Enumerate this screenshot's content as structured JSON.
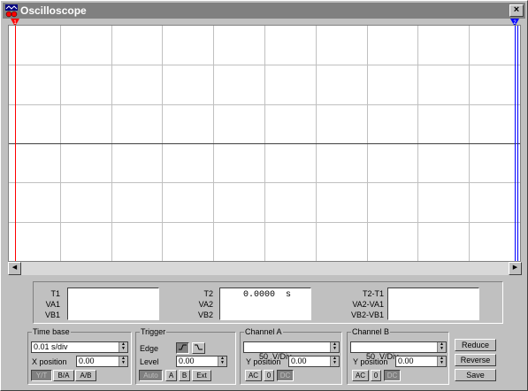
{
  "window": {
    "title": "Oscilloscope",
    "close_label": "×"
  },
  "screen": {
    "background": "#ffffff",
    "grid_color": "#c0c0c0",
    "axis_color": "#404040",
    "cursor1_label": "1",
    "cursor2_label": "2",
    "cursor1_color": "#ff0000",
    "cursor2_color": "#0000ff"
  },
  "readout": {
    "t1_labels": [
      "T1",
      "VA1",
      "VB1"
    ],
    "t1_value": "",
    "t2_labels": [
      "T2",
      "VA2",
      "VB2"
    ],
    "t2_value": "0.0000  s",
    "diff_labels": [
      "T2-T1",
      "VA2-VA1",
      "VB2-VB1"
    ],
    "diff_value": ""
  },
  "timebase": {
    "label": "Time base",
    "scale": "0.01 s/div",
    "xpos_label": "X position",
    "xpos_value": "0.00",
    "modes": [
      "Y/T",
      "B/A",
      "A/B"
    ],
    "active_mode": "Y/T"
  },
  "trigger": {
    "label": "Trigger",
    "edge_label": "Edge",
    "level_label": "Level",
    "level_value": "0.00",
    "sources": [
      "Auto",
      "A",
      "B",
      "Ext"
    ],
    "active_source": "Auto"
  },
  "channel_a": {
    "label": "Channel A",
    "scale": "50  V/Div",
    "ypos_label": "Y position",
    "ypos_value": "0.00",
    "couplings": [
      "AC",
      "0",
      "DC"
    ],
    "active_coupling": "DC"
  },
  "channel_b": {
    "label": "Channel B",
    "scale": "50  V/Div",
    "ypos_label": "Y position",
    "ypos_value": "0.00",
    "couplings": [
      "AC",
      "0",
      "DC"
    ],
    "active_coupling": "DC"
  },
  "actions": {
    "reduce": "Reduce",
    "reverse": "Reverse",
    "save": "Save"
  }
}
